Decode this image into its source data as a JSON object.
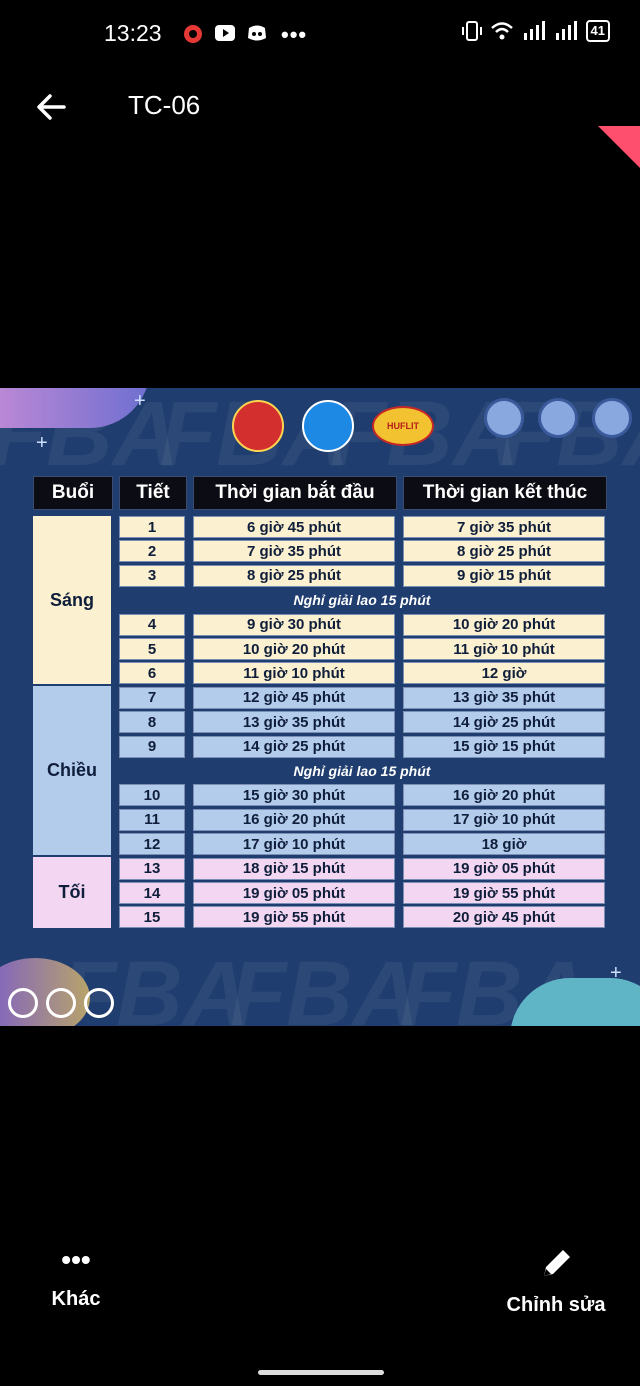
{
  "status_bar": {
    "time": "13:23",
    "battery": "41"
  },
  "app_bar": {
    "title": "TC-06"
  },
  "image": {
    "logo_text": "HUFLIT",
    "watermark": "FBA",
    "headers": [
      "Buổi",
      "Tiết",
      "Thời gian bắt đầu",
      "Thời gian kết thúc"
    ],
    "sessions": [
      {
        "name": "Sáng",
        "color": "#fbf0cf"
      },
      {
        "name": "Chiều",
        "color": "#b4ccec"
      },
      {
        "name": "Tối",
        "color": "#f3d6f1"
      }
    ],
    "break_text": "Nghỉ giải lao 15 phút",
    "rows": [
      {
        "period": "1",
        "start": "6 giờ 45 phút",
        "end": "7 giờ 35 phút"
      },
      {
        "period": "2",
        "start": "7 giờ 35 phút",
        "end": "8 giờ 25 phút"
      },
      {
        "period": "3",
        "start": "8 giờ 25 phút",
        "end": "9 giờ 15 phút"
      },
      {
        "period": "4",
        "start": "9 giờ 30 phút",
        "end": "10 giờ 20 phút"
      },
      {
        "period": "5",
        "start": "10 giờ 20 phút",
        "end": "11 giờ 10 phút"
      },
      {
        "period": "6",
        "start": "11 giờ 10 phút",
        "end": "12 giờ"
      },
      {
        "period": "7",
        "start": "12 giờ 45 phút",
        "end": "13 giờ 35 phút"
      },
      {
        "period": "8",
        "start": "13 giờ 35 phút",
        "end": "14 giờ 25 phút"
      },
      {
        "period": "9",
        "start": "14 giờ 25 phút",
        "end": "15 giờ 15 phút"
      },
      {
        "period": "10",
        "start": "15 giờ 30 phút",
        "end": "16 giờ 20 phút"
      },
      {
        "period": "11",
        "start": "16 giờ 20 phút",
        "end": "17 giờ 10 phút"
      },
      {
        "period": "12",
        "start": "17 giờ 10 phút",
        "end": "18 giờ"
      },
      {
        "period": "13",
        "start": "18 giờ 15 phút",
        "end": "19 giờ 05 phút"
      },
      {
        "period": "14",
        "start": "19 giờ 05 phút",
        "end": "19 giờ 55 phút"
      },
      {
        "period": "15",
        "start": "19 giờ 55 phút",
        "end": "20 giờ 45 phút"
      }
    ]
  },
  "bottom_bar": {
    "more_label": "Khác",
    "edit_label": "Chỉnh sửa"
  }
}
